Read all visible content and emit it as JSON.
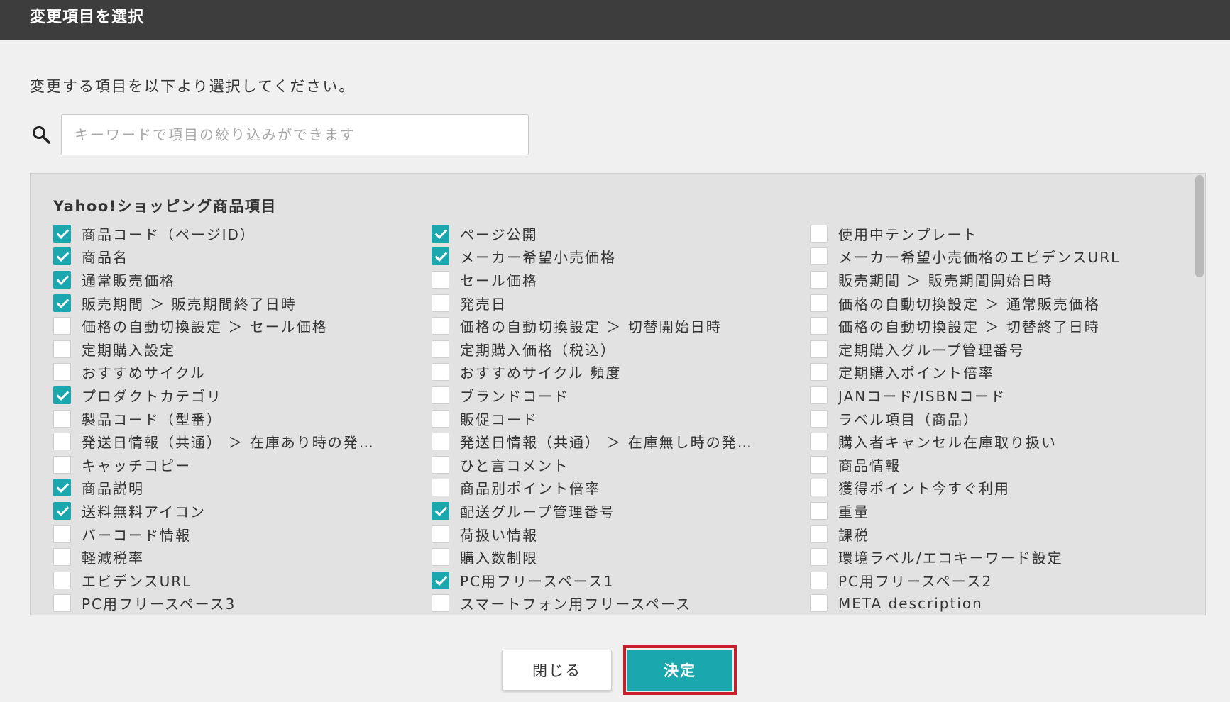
{
  "dialog": {
    "title": "変更項目を選択",
    "instruction": "変更する項目を以下より選択してください。"
  },
  "search": {
    "icon": "search-icon",
    "placeholder": "キーワードで項目の絞り込みができます",
    "value": ""
  },
  "section": {
    "title": "Yahoo!ショッピング商品項目",
    "items": [
      {
        "label": "商品コード（ページID）",
        "checked": true
      },
      {
        "label": "ページ公開",
        "checked": true
      },
      {
        "label": "使用中テンプレート",
        "checked": false
      },
      {
        "label": "商品名",
        "checked": true
      },
      {
        "label": "メーカー希望小売価格",
        "checked": true
      },
      {
        "label": "メーカー希望小売価格のエビデンスURL",
        "checked": false
      },
      {
        "label": "通常販売価格",
        "checked": true
      },
      {
        "label": "セール価格",
        "checked": false
      },
      {
        "label": "販売期間 ＞ 販売期間開始日時",
        "checked": false
      },
      {
        "label": "販売期間 ＞ 販売期間終了日時",
        "checked": true
      },
      {
        "label": "発売日",
        "checked": false
      },
      {
        "label": "価格の自動切換設定 ＞ 通常販売価格",
        "checked": false
      },
      {
        "label": "価格の自動切換設定 ＞ セール価格",
        "checked": false
      },
      {
        "label": "価格の自動切換設定 ＞ 切替開始日時",
        "checked": false
      },
      {
        "label": "価格の自動切換設定 ＞ 切替終了日時",
        "checked": false
      },
      {
        "label": "定期購入設定",
        "checked": false
      },
      {
        "label": "定期購入価格（税込）",
        "checked": false
      },
      {
        "label": "定期購入グループ管理番号",
        "checked": false
      },
      {
        "label": "おすすめサイクル",
        "checked": false
      },
      {
        "label": "おすすめサイクル 頻度",
        "checked": false
      },
      {
        "label": "定期購入ポイント倍率",
        "checked": false
      },
      {
        "label": "プロダクトカテゴリ",
        "checked": true
      },
      {
        "label": "ブランドコード",
        "checked": false
      },
      {
        "label": "JANコード/ISBNコード",
        "checked": false
      },
      {
        "label": "製品コード（型番）",
        "checked": false
      },
      {
        "label": "販促コード",
        "checked": false
      },
      {
        "label": "ラベル項目（商品）",
        "checked": false
      },
      {
        "label": "発送日情報（共通） ＞ 在庫あり時の発…",
        "checked": false
      },
      {
        "label": "発送日情報（共通） ＞ 在庫無し時の発…",
        "checked": false
      },
      {
        "label": "購入者キャンセル在庫取り扱い",
        "checked": false
      },
      {
        "label": "キャッチコピー",
        "checked": false
      },
      {
        "label": "ひと言コメント",
        "checked": false
      },
      {
        "label": "商品情報",
        "checked": false
      },
      {
        "label": "商品説明",
        "checked": true
      },
      {
        "label": "商品別ポイント倍率",
        "checked": false
      },
      {
        "label": "獲得ポイント今すぐ利用",
        "checked": false
      },
      {
        "label": "送料無料アイコン",
        "checked": true
      },
      {
        "label": "配送グループ管理番号",
        "checked": true
      },
      {
        "label": "重量",
        "checked": false
      },
      {
        "label": "バーコード情報",
        "checked": false
      },
      {
        "label": "荷扱い情報",
        "checked": false
      },
      {
        "label": "課税",
        "checked": false
      },
      {
        "label": "軽減税率",
        "checked": false
      },
      {
        "label": "購入数制限",
        "checked": false
      },
      {
        "label": "環境ラベル/エコキーワード設定",
        "checked": false
      },
      {
        "label": "エビデンスURL",
        "checked": false
      },
      {
        "label": "PC用フリースペース1",
        "checked": true
      },
      {
        "label": "PC用フリースペース2",
        "checked": false
      },
      {
        "label": "PC用フリースペース3",
        "checked": false
      },
      {
        "label": "スマートフォン用フリースペース",
        "checked": false
      },
      {
        "label": "META description",
        "checked": false
      }
    ]
  },
  "buttons": {
    "close_label": "閉じる",
    "decide_label": "決定"
  },
  "colors": {
    "header_bg": "#3d3d3d",
    "accent": "#1aa7ad",
    "highlight_outline": "#c8202a",
    "panel_bg": "#e2e2e2"
  }
}
